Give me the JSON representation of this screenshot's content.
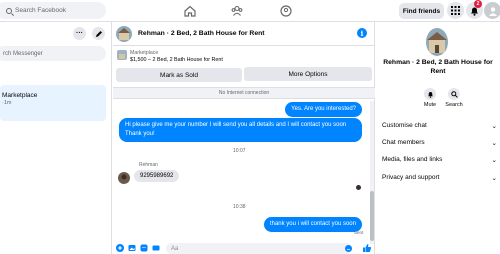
{
  "topbar": {
    "search_placeholder": "Search Facebook",
    "find_friends": "Find friends",
    "notification_count": "2"
  },
  "left": {
    "search_placeholder": "rch Messenger",
    "conversation": {
      "title": " Marketplace",
      "sub": "·1m"
    }
  },
  "chat": {
    "title": "Rehman · 2 Bed, 2 Bath House for Rent",
    "marketplace_label": "Marketplace",
    "listing_price": "$1,500 – 2 Bed, 2 Bath House for Rent",
    "mark_sold": "Mark as Sold",
    "more_options": "More Options",
    "no_internet": "No Internet connection",
    "msg1": "Yes. Are you interested?",
    "msg2": "Hi please give me your number I will send you all details and I will contact you soon Thank you!",
    "time1": "10:07",
    "sender": "Rehman",
    "msg3": "9295989692",
    "time2": "10:38",
    "msg4": "thank you i will contact you soon",
    "sent": "Sent",
    "composer_placeholder": "Aa"
  },
  "right": {
    "name": "Rehman · 2 Bed, 2 Bath House for Rent",
    "mute": "Mute",
    "search": "Search",
    "sections": [
      "Customise chat",
      "Chat members",
      "Media, files and links",
      "Privacy and support"
    ]
  },
  "colors": {
    "accent": "#0084ff",
    "badge": "#e41e3f"
  }
}
